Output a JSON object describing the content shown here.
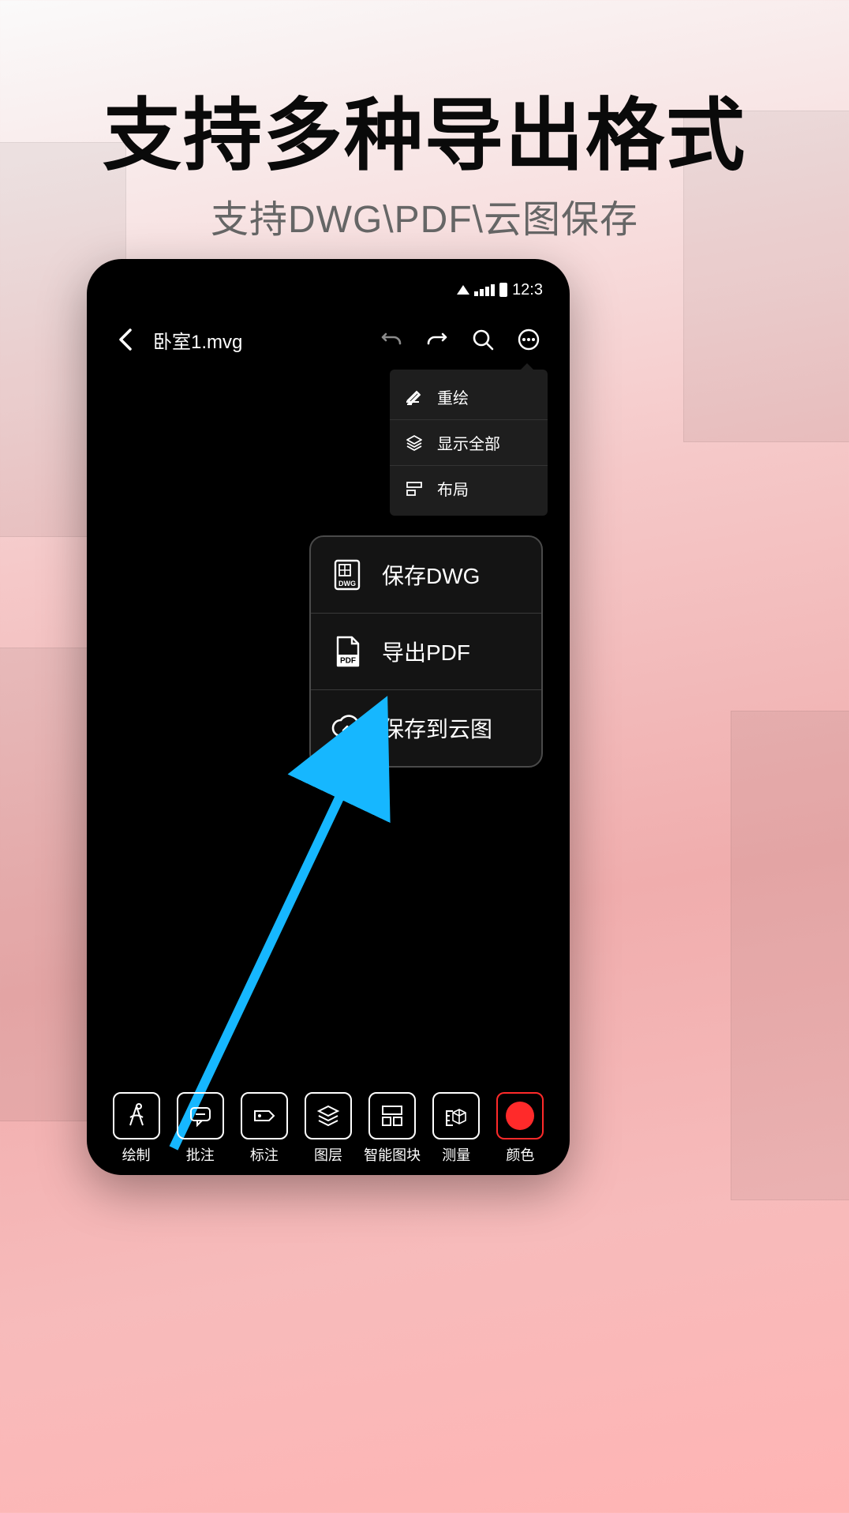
{
  "marketing": {
    "headline": "支持多种导出格式",
    "subhead": "支持DWG\\PDF\\云图保存"
  },
  "status": {
    "time": "12:3"
  },
  "appbar": {
    "file_title": "卧室1.mvg"
  },
  "menu_small": {
    "items": [
      {
        "label": "重绘"
      },
      {
        "label": "显示全部"
      },
      {
        "label": "布局"
      }
    ]
  },
  "menu_big": {
    "items": [
      {
        "label": "保存DWG"
      },
      {
        "label": "导出PDF"
      },
      {
        "label": "保存到云图"
      }
    ]
  },
  "bottom": {
    "items": [
      {
        "label": "绘制"
      },
      {
        "label": "批注"
      },
      {
        "label": "标注"
      },
      {
        "label": "图层"
      },
      {
        "label": "智能图块"
      },
      {
        "label": "测量"
      },
      {
        "label": "颜色"
      }
    ]
  },
  "icon_text": {
    "dwg": "DWG",
    "pdf": "PDF"
  },
  "colors": {
    "arrow": "#16b7ff",
    "record": "#ff2a2a"
  }
}
